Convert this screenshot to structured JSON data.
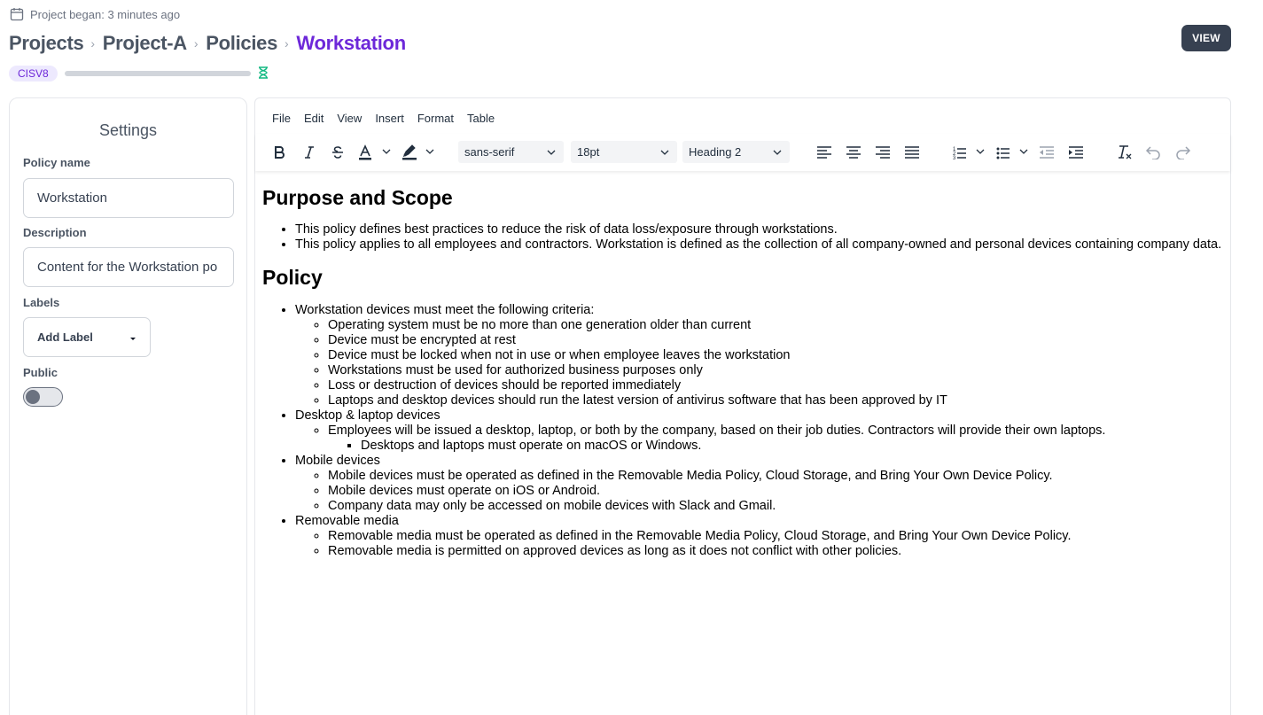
{
  "header": {
    "project_began": "Project began: 3 minutes ago",
    "breadcrumb": [
      "Projects",
      "Project-A",
      "Policies",
      "Workstation"
    ],
    "view_button": "VIEW",
    "badge": "CISV8",
    "progress": 0
  },
  "settings": {
    "title": "Settings",
    "policy_name_label": "Policy name",
    "policy_name_value": "Workstation",
    "description_label": "Description",
    "description_value": "Content for the Workstation po",
    "labels_label": "Labels",
    "add_label": "Add Label",
    "public_label": "Public",
    "public_on": false
  },
  "editor": {
    "menu": [
      "File",
      "Edit",
      "View",
      "Insert",
      "Format",
      "Table"
    ],
    "font_family": "sans-serif",
    "font_size": "18pt",
    "block_format": "Heading 2",
    "accent_color": "#6d28d9",
    "icons": [
      "bold-icon",
      "italic-icon",
      "strikethrough-icon",
      "text-color-icon",
      "highlight-icon",
      "align-left-icon",
      "align-center-icon",
      "align-right-icon",
      "justify-icon",
      "numbered-list-icon",
      "bullet-list-icon",
      "outdent-icon",
      "indent-icon",
      "clear-format-icon",
      "undo-icon",
      "redo-icon"
    ]
  },
  "document": {
    "h1": "Purpose and Scope",
    "purpose": [
      "This policy defines best practices to reduce the risk of data loss/exposure through workstations.",
      "This policy applies to all employees and contractors. Workstation is defined as the collection of all company-owned and personal devices containing company data."
    ],
    "h2": "Policy",
    "policy": {
      "workstation": {
        "title": "Workstation devices must meet the following criteria:",
        "items": [
          "Operating system must be no more than one generation older than current",
          "Device must be encrypted at rest",
          "Device must be locked when not in use or when employee leaves the workstation",
          "Workstations must be used for authorized business purposes only",
          "Loss or destruction of devices should be reported immediately",
          "Laptops and desktop devices should run the latest version of antivirus software that has been approved by IT"
        ]
      },
      "desktop": {
        "title": "Desktop & laptop devices",
        "item": "Employees will be issued a desktop, laptop, or both by the company, based on their job duties. Contractors will provide their own laptops.",
        "subitem": "Desktops and laptops must operate on macOS or Windows."
      },
      "mobile": {
        "title": "Mobile devices",
        "items": [
          "Mobile devices must be operated as defined in the Removable Media Policy, Cloud Storage, and Bring Your Own Device Policy.",
          "Mobile devices must operate on iOS or Android.",
          "Company data may only be accessed on mobile devices with Slack and Gmail."
        ]
      },
      "removable": {
        "title": "Removable media",
        "items": [
          "Removable media must be operated as defined in the Removable Media Policy, Cloud Storage, and Bring Your Own Device Policy.",
          "Removable media is permitted on approved devices as long as it does not conflict with other policies."
        ]
      }
    }
  }
}
